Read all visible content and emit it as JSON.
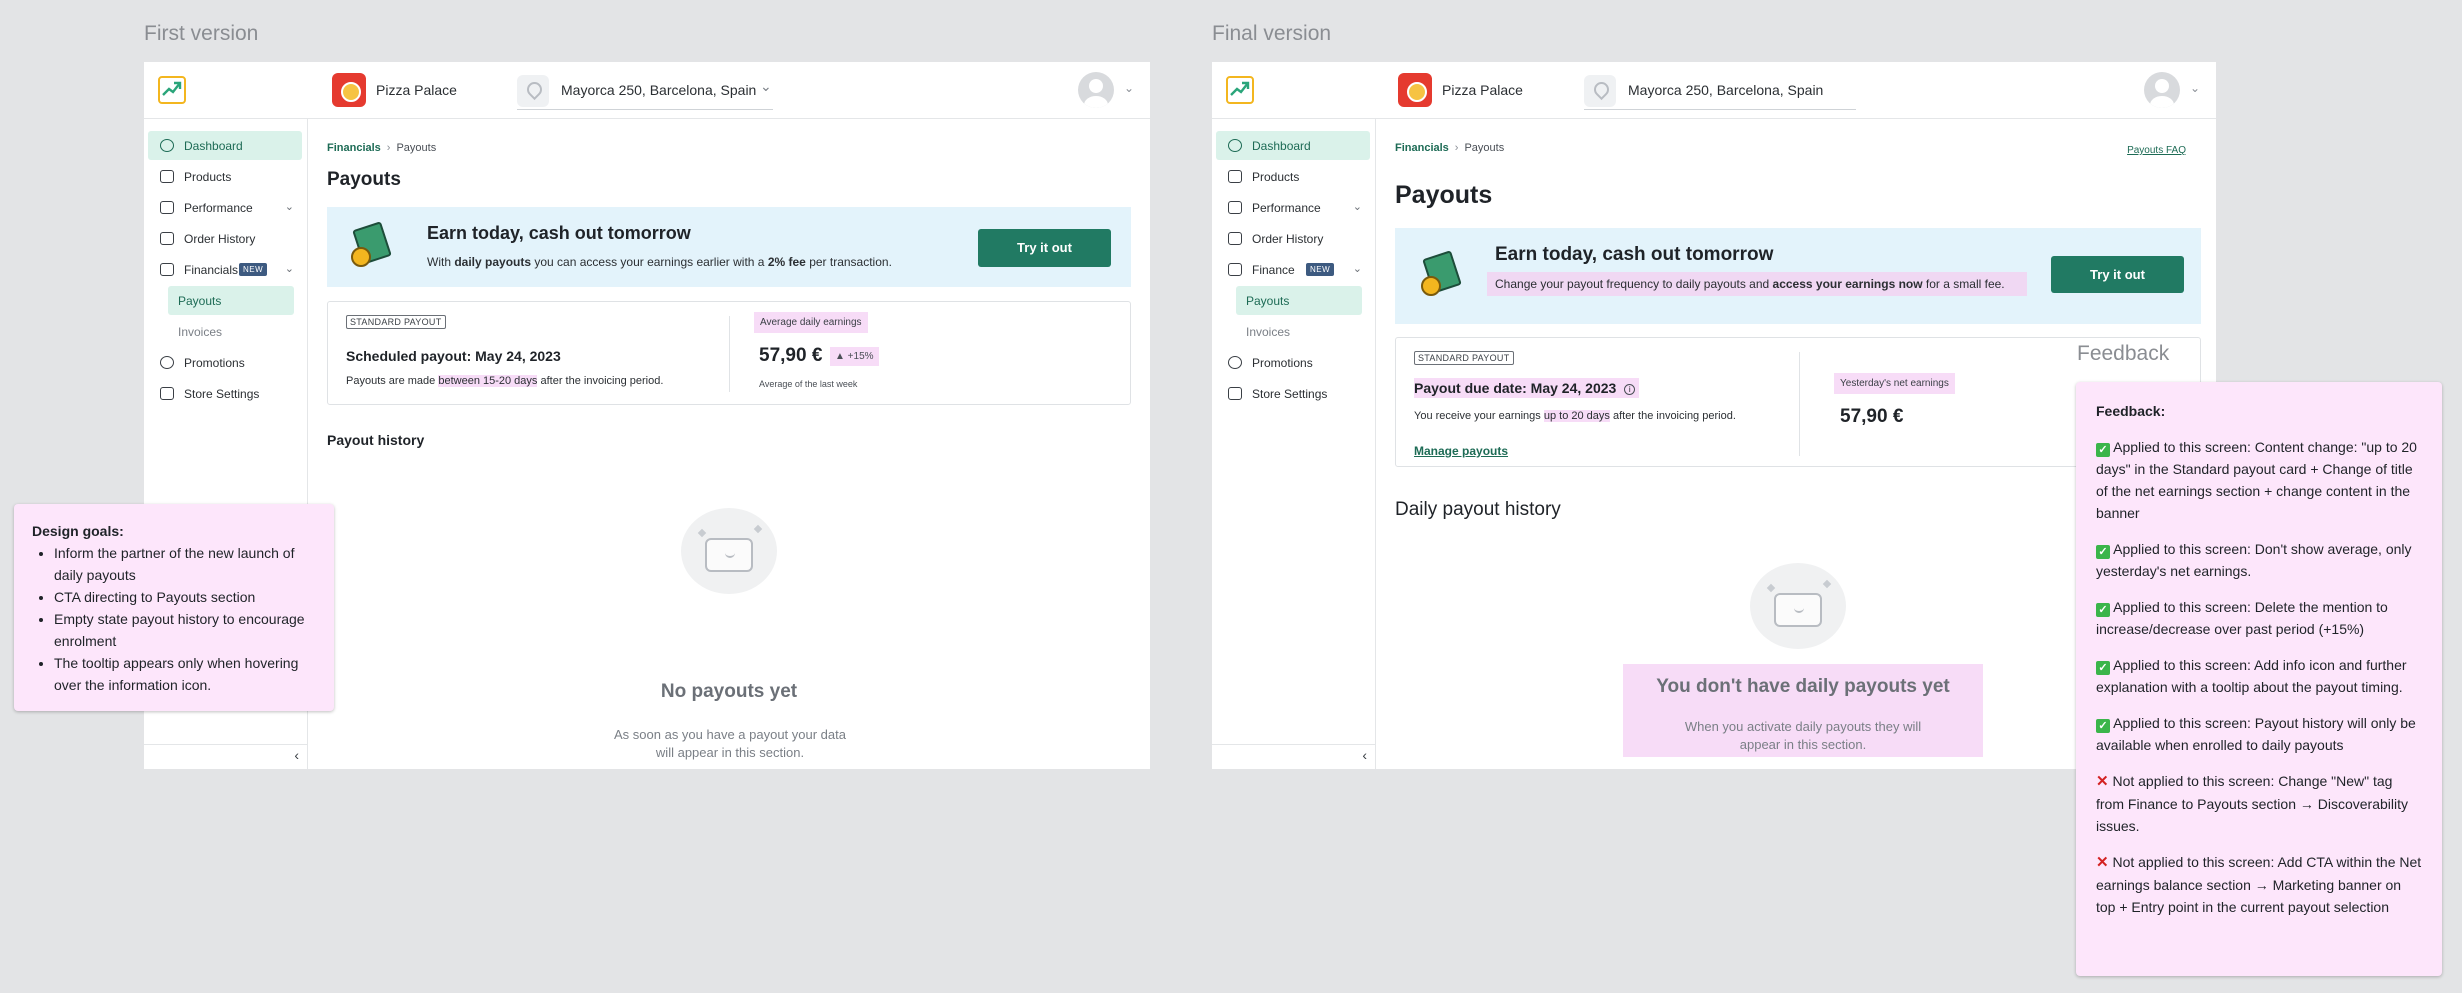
{
  "labels": {
    "first_version": "First version",
    "final_version": "Final version",
    "feedback_heading": "Feedback"
  },
  "colors": {
    "accent": "#217a63",
    "banner_bg": "#e3f3fb",
    "highlight": "#f7dcf7",
    "note_bg": "#fde6fb"
  },
  "first": {
    "topbar": {
      "brand": "Pizza Palace",
      "location": "Mayorca 250, Barcelona, Spain"
    },
    "sidebar": {
      "items": [
        {
          "label": "Dashboard",
          "icon": "speedometer-icon"
        },
        {
          "label": "Products",
          "icon": "box-icon"
        },
        {
          "label": "Performance",
          "icon": "chart-icon"
        },
        {
          "label": "Order History",
          "icon": "receipt-search-icon"
        },
        {
          "label": "Financials",
          "icon": "money-icon",
          "badge": "NEW"
        },
        {
          "label": "Payouts"
        },
        {
          "label": "Invoices"
        },
        {
          "label": "Promotions",
          "icon": "percent-icon"
        },
        {
          "label": "Store Settings",
          "icon": "store-icon"
        }
      ]
    },
    "breadcrumb": {
      "parent": "Financials",
      "current": "Payouts"
    },
    "title": "Payouts",
    "banner": {
      "title": "Earn today, cash out tomorrow",
      "text_pre": "With ",
      "text_bold1": "daily payouts",
      "text_mid": " you can access your earnings earlier with a ",
      "text_bold2": "2% fee",
      "text_post": " per transaction.",
      "cta": "Try it out"
    },
    "card": {
      "tag": "STANDARD PAYOUT",
      "title": "Scheduled payout: May 24, 2023",
      "text_pre": "Payouts are made ",
      "text_hl": "between 15-20 days",
      "text_post": " after the invoicing period.",
      "right_label": "Average daily earnings",
      "amount": "57,90 €",
      "change": "▲ +15%",
      "sub": "Average of the last week"
    },
    "history_title": "Payout history",
    "empty": {
      "title": "No payouts yet",
      "text": "As soon as you have a payout your data will appear in this section."
    }
  },
  "final": {
    "topbar": {
      "brand": "Pizza Palace",
      "location": "Mayorca 250, Barcelona, Spain"
    },
    "sidebar": {
      "items": [
        {
          "label": "Dashboard"
        },
        {
          "label": "Products"
        },
        {
          "label": "Performance"
        },
        {
          "label": "Order History"
        },
        {
          "label": "Finance",
          "badge": "NEW"
        },
        {
          "label": "Payouts"
        },
        {
          "label": "Invoices"
        },
        {
          "label": "Promotions"
        },
        {
          "label": "Store Settings"
        }
      ]
    },
    "breadcrumb": {
      "parent": "Financials",
      "current": "Payouts"
    },
    "faq": "Payouts FAQ",
    "title": "Payouts",
    "banner": {
      "title": "Earn today, cash out tomorrow",
      "text_pre": "Change your payout frequency to daily payouts and ",
      "text_bold": "access your earnings now",
      "text_post": " for a small fee.",
      "cta": "Try it out"
    },
    "card": {
      "tag": "STANDARD PAYOUT",
      "title": "Payout due date: May 24, 2023",
      "info": "i",
      "text_pre": "You receive your earnings ",
      "text_hl": "up to 20 days",
      "text_post": " after the invoicing period.",
      "link": "Manage payouts",
      "right_label": "Yesterday's net earnings",
      "amount": "57,90 €"
    },
    "history_title": "Daily payout history",
    "empty": {
      "title": "You don't have daily payouts yet",
      "text": "When you activate daily payouts they will appear in this section."
    }
  },
  "design_goals": {
    "title": "Design goals:",
    "items": [
      "Inform the partner of the new launch of daily payouts",
      "CTA directing to Payouts section",
      "Empty state payout history to encourage enrolment",
      "The tooltip appears only when hovering over the information icon."
    ]
  },
  "feedback": {
    "title": "Feedback:",
    "items": [
      {
        "status": "ok",
        "text": "Applied to this screen: Content change: \"up to 20 days\" in the Standard payout card + Change of title of the net earnings section + change content in the banner"
      },
      {
        "status": "ok",
        "text": "Applied to this screen: Don't show average, only yesterday's net earnings."
      },
      {
        "status": "ok",
        "text": "Applied to this screen: Delete the mention to increase/decrease over past period (+15%)"
      },
      {
        "status": "ok",
        "text": "Applied to this screen: Add info icon and further explanation with a tooltip about the payout timing."
      },
      {
        "status": "ok",
        "text": "Applied to this screen: Payout history will only be available when enrolled to daily payouts"
      },
      {
        "status": "no",
        "text": "Not applied to this screen: Change \"New\" tag from Finance to Payouts section → Discoverability issues."
      },
      {
        "status": "no",
        "text": "Not applied to this screen: Add CTA within the Net earnings balance section → Marketing banner on top + Entry point in the current payout selection"
      }
    ]
  }
}
